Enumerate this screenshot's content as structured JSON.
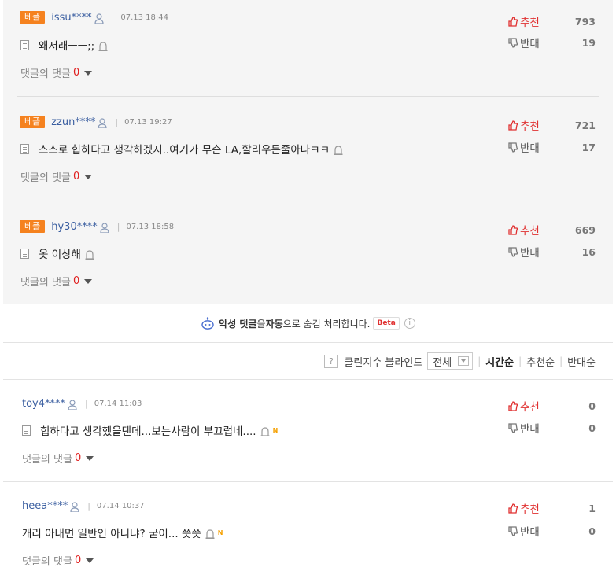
{
  "best_comments": [
    {
      "badge": "베플",
      "user": "issu****",
      "time": "07.13 18:44",
      "text": "왜저래ㅡㅡ;;",
      "reply_label": "댓글의 댓글",
      "reply_count": "0",
      "up_label": "추천",
      "up_count": "793",
      "down_label": "반대",
      "down_count": "19"
    },
    {
      "badge": "베플",
      "user": "zzun****",
      "time": "07.13 19:27",
      "text": "스스로 힙하다고 생각하겠지..여기가 무슨 LA,할리우든줄아나ㅋㅋ",
      "reply_label": "댓글의 댓글",
      "reply_count": "0",
      "up_label": "추천",
      "up_count": "721",
      "down_label": "반대",
      "down_count": "17"
    },
    {
      "badge": "베플",
      "user": "hy30****",
      "time": "07.13 18:58",
      "text": "옷 이상해",
      "reply_label": "댓글의 댓글",
      "reply_count": "0",
      "up_label": "추천",
      "up_count": "669",
      "down_label": "반대",
      "down_count": "16"
    }
  ],
  "notice": {
    "pre": "악성 댓글",
    "mid1": "을 ",
    "bold2": "자동",
    "post": "으로 숨김 처리합니다.",
    "beta": "Beta",
    "info": "i"
  },
  "filter": {
    "help": "?",
    "clean_label": "클린지수 블라인드",
    "select_value": "전체",
    "sort_time": "시간순",
    "sort_up": "추천순",
    "sort_down": "반대순"
  },
  "comments": [
    {
      "user": "toy4****",
      "time": "07.14 11:03",
      "text": "힙하다고 생각했을텐데...보는사람이 부끄럽네....",
      "new_mark": "N",
      "reply_label": "댓글의 댓글",
      "reply_count": "0",
      "up_label": "추천",
      "up_count": "0",
      "down_label": "반대",
      "down_count": "0"
    },
    {
      "user": "heea****",
      "time": "07.14 10:37",
      "text": "개리 아내면 일반인 아니냐? 굳이... 쯧쯧",
      "new_mark": "N",
      "reply_label": "댓글의 댓글",
      "reply_count": "0",
      "up_label": "추천",
      "up_count": "1",
      "down_label": "반대",
      "down_count": "0"
    }
  ],
  "colors": {
    "badge": "#f5821f",
    "user": "#3a5ea0",
    "up": "#e03030",
    "reply_count": "#e02020",
    "best_bg": "#f5f5f5"
  },
  "icons": [
    "person-icon",
    "document-icon",
    "siren-report-icon",
    "thumb-up-icon",
    "thumb-down-icon",
    "caret-down-icon",
    "bot-icon",
    "info-icon",
    "help-icon"
  ]
}
